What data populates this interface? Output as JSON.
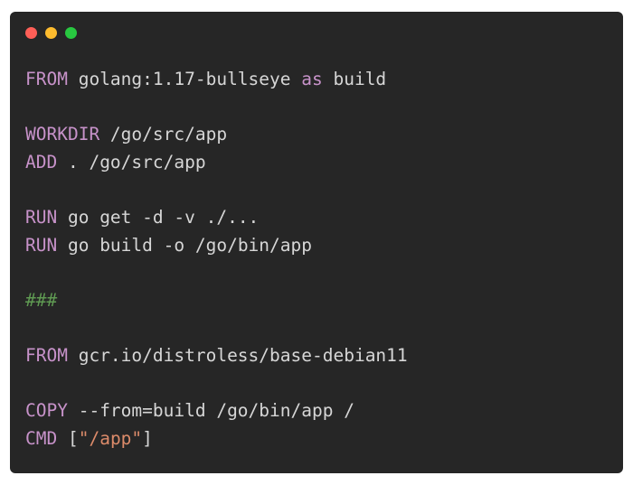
{
  "window": {
    "controls": [
      {
        "name": "close-dot",
        "color": "#ff5f57"
      },
      {
        "name": "minimize-dot",
        "color": "#febc2e"
      },
      {
        "name": "maximize-dot",
        "color": "#28c840"
      }
    ]
  },
  "colors": {
    "background": "#262626",
    "text": "#d6d6d6",
    "keyword": "#c792c9",
    "string": "#dc8b6a",
    "comment": "#5f9a52"
  },
  "code": {
    "lines": [
      [
        {
          "t": "FROM",
          "c": "kw"
        },
        {
          "t": " golang:1.17-bullseye ",
          "c": "txt"
        },
        {
          "t": "as",
          "c": "kw"
        },
        {
          "t": " build",
          "c": "txt"
        }
      ],
      [],
      [
        {
          "t": "WORKDIR",
          "c": "kw"
        },
        {
          "t": " /go/src/app",
          "c": "txt"
        }
      ],
      [
        {
          "t": "ADD",
          "c": "kw"
        },
        {
          "t": " . /go/src/app",
          "c": "txt"
        }
      ],
      [],
      [
        {
          "t": "RUN",
          "c": "kw"
        },
        {
          "t": " go get -d -v ./...",
          "c": "txt"
        }
      ],
      [
        {
          "t": "RUN",
          "c": "kw"
        },
        {
          "t": " go build -o /go/bin/app",
          "c": "txt"
        }
      ],
      [],
      [
        {
          "t": "###",
          "c": "cmt"
        }
      ],
      [],
      [
        {
          "t": "FROM",
          "c": "kw"
        },
        {
          "t": " gcr.io/distroless/base-debian11",
          "c": "txt"
        }
      ],
      [],
      [
        {
          "t": "COPY",
          "c": "kw"
        },
        {
          "t": " --from=build /go/bin/app /",
          "c": "txt"
        }
      ],
      [
        {
          "t": "CMD",
          "c": "kw"
        },
        {
          "t": " [",
          "c": "txt"
        },
        {
          "t": "\"/app\"",
          "c": "str"
        },
        {
          "t": "]",
          "c": "txt"
        }
      ]
    ]
  }
}
